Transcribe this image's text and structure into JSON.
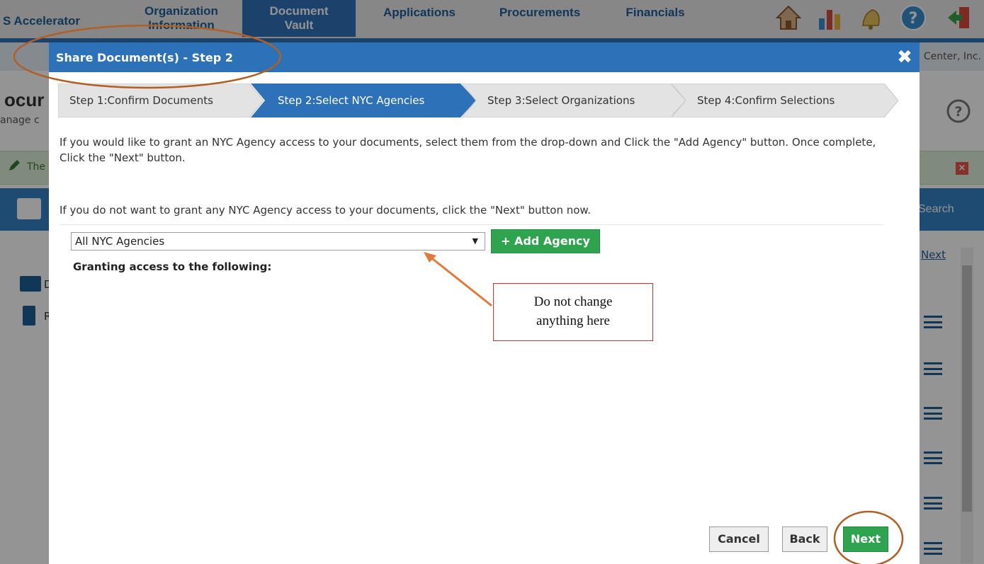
{
  "background": {
    "nav": {
      "accelerator": "S Accelerator",
      "org_info_l1": "Organization",
      "org_info_l2": "Information",
      "vault_l1": "Document",
      "vault_l2": "Vault",
      "applications": "Applications",
      "procurements": "Procurements",
      "financials": "Financials"
    },
    "org_name": "Center, Inc.",
    "page_title": "ocur",
    "page_subtitle": "anage c",
    "alert_text": "The",
    "toolbar_search": "Search",
    "pager_next": "Next",
    "row_letter_1": "D",
    "row_letter_2": "R"
  },
  "modal": {
    "title": "Share Document(s)  - Step 2",
    "close_label": "✖",
    "steps": [
      {
        "label": "Step 1:Confirm Documents"
      },
      {
        "label": "Step 2:Select NYC Agencies"
      },
      {
        "label": "Step 3:Select Organizations"
      },
      {
        "label": "Step 4:Confirm Selections"
      }
    ],
    "instruction_1": "If you would like to grant an NYC Agency access to your documents, select them from the drop-down and Click the \"Add Agency\" button. Once complete, Click the \"Next\" button.",
    "instruction_2": "If you do not want to grant any NYC Agency access to your documents, click the \"Next\" button now.",
    "agency_select_value": "All NYC Agencies",
    "add_agency_label": "+ Add Agency",
    "granting_label": "Granting access to the following:",
    "buttons": {
      "cancel": "Cancel",
      "back": "Back",
      "next": "Next"
    }
  },
  "annotation": {
    "callout_l1": "Do not change",
    "callout_l2": "anything here"
  },
  "colors": {
    "primary_blue": "#2d72b8",
    "active_step": "#2d72b8",
    "green_button": "#2ea44f",
    "annotation_brown": "#b05f25",
    "annotation_orange": "#e07b39",
    "callout_border": "#d03030"
  }
}
